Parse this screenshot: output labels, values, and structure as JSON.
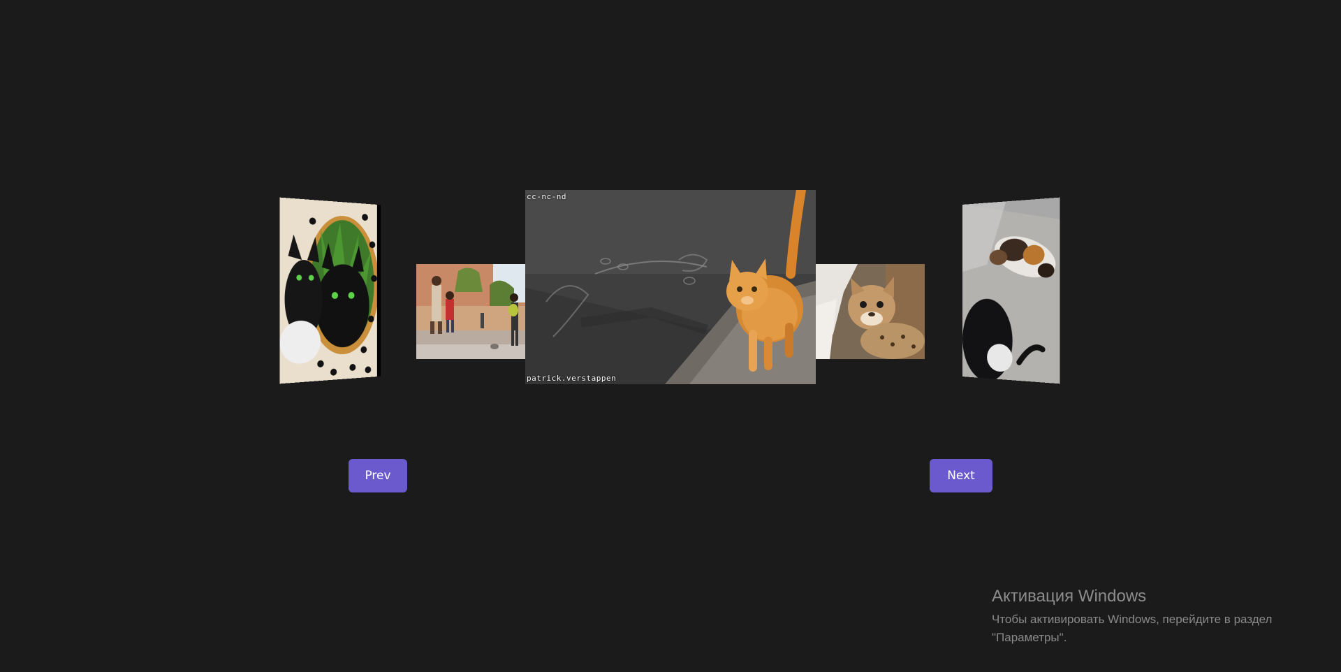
{
  "carousel": {
    "slides": [
      {
        "name": "slide-black-cats",
        "caption_top": "",
        "caption_bottom": ""
      },
      {
        "name": "slide-street-walkers",
        "caption_top": "",
        "caption_bottom": ""
      },
      {
        "name": "slide-orange-cat",
        "caption_top": "cc-nc-nd",
        "caption_bottom": "patrick.verstappen"
      },
      {
        "name": "slide-cub",
        "caption_top": "",
        "caption_bottom": ""
      },
      {
        "name": "slide-calico-cats",
        "caption_top": "",
        "caption_bottom": ""
      }
    ],
    "prev_label": "Prev",
    "next_label": "Next",
    "accent_color": "#6a5acd"
  },
  "watermark": {
    "title": "Активация Windows",
    "line1": "Чтобы активировать Windows, перейдите в раздел",
    "line2": "\"Параметры\"."
  }
}
